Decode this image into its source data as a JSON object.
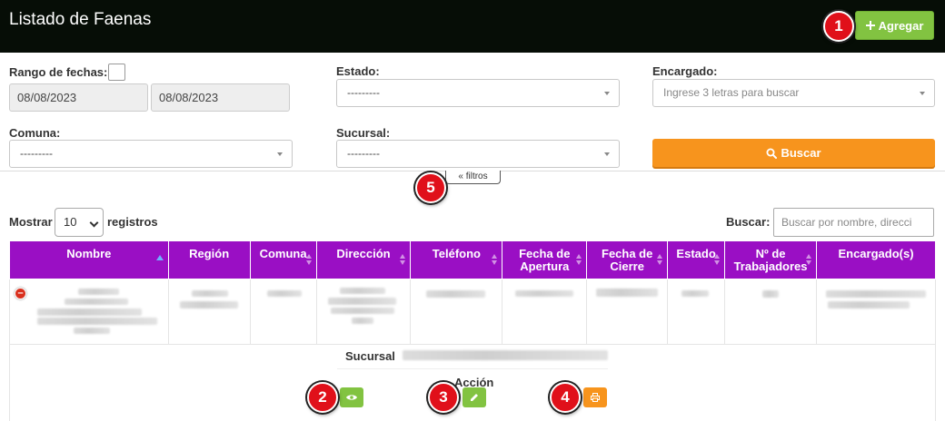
{
  "header": {
    "title": "Listado de Faenas",
    "add_button": "Agregar",
    "add_icon": "plus-icon"
  },
  "annotations": [
    "1",
    "2",
    "3",
    "4",
    "5"
  ],
  "filters": {
    "date_range_label": "Rango de fechas:",
    "date_from": "08/08/2023",
    "date_to": "08/08/2023",
    "estado_label": "Estado:",
    "estado_value": "---------",
    "encargado_label": "Encargado:",
    "encargado_placeholder": "Ingrese 3 letras para buscar",
    "comuna_label": "Comuna:",
    "comuna_value": "---------",
    "sucursal_label": "Sucursal:",
    "sucursal_value": "---------",
    "search_button": "Buscar",
    "toggle_label": "filtros"
  },
  "table_controls": {
    "show_label": "Mostrar",
    "page_length": "10",
    "records_label": "registros",
    "search_label": "Buscar:",
    "search_placeholder": "Buscar por nombre, direcci"
  },
  "table": {
    "columns": [
      "Nombre",
      "Región",
      "Comuna",
      "Dirección",
      "Teléfono",
      "Fecha de Apertura",
      "Fecha de Cierre",
      "Estado",
      "Nº de Trabajadores",
      "Encargado(s)"
    ],
    "header_color": "#9a0fc4"
  },
  "detail": {
    "sucursal_label": "Sucursal",
    "accion_label": "Acción",
    "actions": [
      "eye-icon",
      "pencil-icon",
      "print-icon"
    ]
  },
  "colors": {
    "topbar": "#060d06",
    "success": "#82c341",
    "warning": "#f7941d",
    "badge": "#e0101a"
  }
}
